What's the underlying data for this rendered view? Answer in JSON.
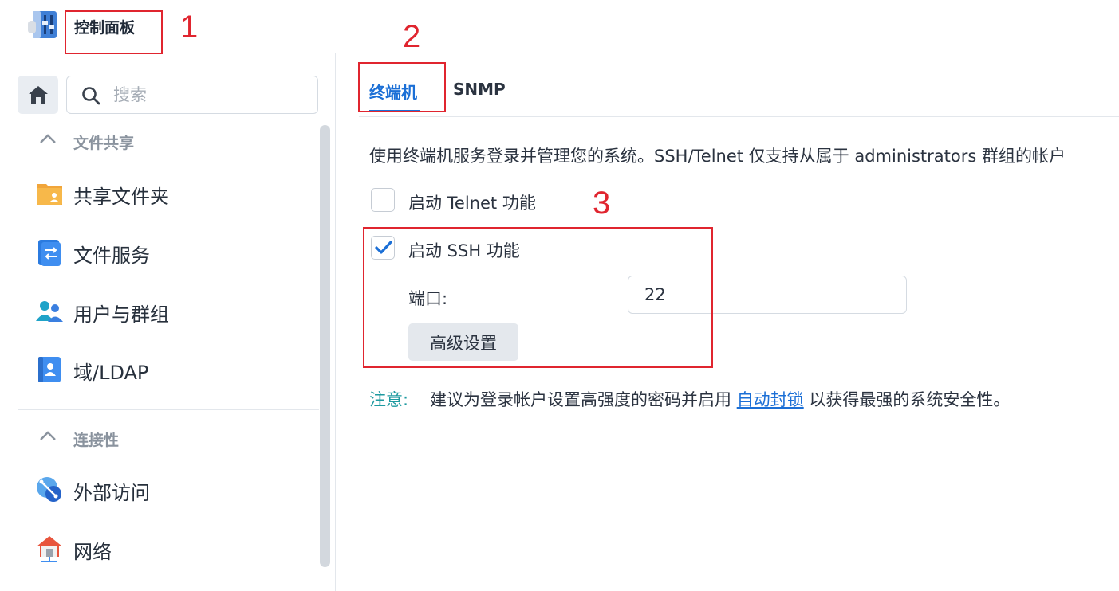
{
  "titlebar": {
    "title": "控制面板",
    "icon": "control-panel-icon"
  },
  "sidebar": {
    "search_placeholder": "搜索",
    "sections": [
      {
        "label": "文件共享",
        "items": [
          {
            "label": "共享文件夹",
            "icon": "shared-folder-icon"
          },
          {
            "label": "文件服务",
            "icon": "file-services-icon"
          },
          {
            "label": "用户与群组",
            "icon": "users-groups-icon"
          },
          {
            "label": "域/LDAP",
            "icon": "domain-ldap-icon"
          }
        ]
      },
      {
        "label": "连接性",
        "items": [
          {
            "label": "外部访问",
            "icon": "external-access-icon"
          },
          {
            "label": "网络",
            "icon": "network-icon"
          }
        ]
      }
    ]
  },
  "main": {
    "tabs": [
      {
        "label": "终端机",
        "active": true
      },
      {
        "label": "SNMP",
        "active": false
      }
    ],
    "description": "使用终端机服务登录并管理您的系统。SSH/Telnet 仅支持从属于 administrators 群组的帐户",
    "telnet": {
      "label": "启动 Telnet 功能",
      "checked": false
    },
    "ssh": {
      "label": "启动 SSH 功能",
      "checked": true
    },
    "port": {
      "label": "端口:",
      "value": "22"
    },
    "advanced_button": "高级设置",
    "note": {
      "label": "注意:",
      "text_before": "建议为登录帐户设置高强度的密码并启用",
      "link": "自动封锁",
      "text_after": "以获得最强的系统安全性。"
    }
  },
  "annotations": [
    "1",
    "2",
    "3"
  ],
  "colors": {
    "accent": "#1b6fd6",
    "note": "#1e9aa0",
    "annotation": "#e0252f"
  }
}
